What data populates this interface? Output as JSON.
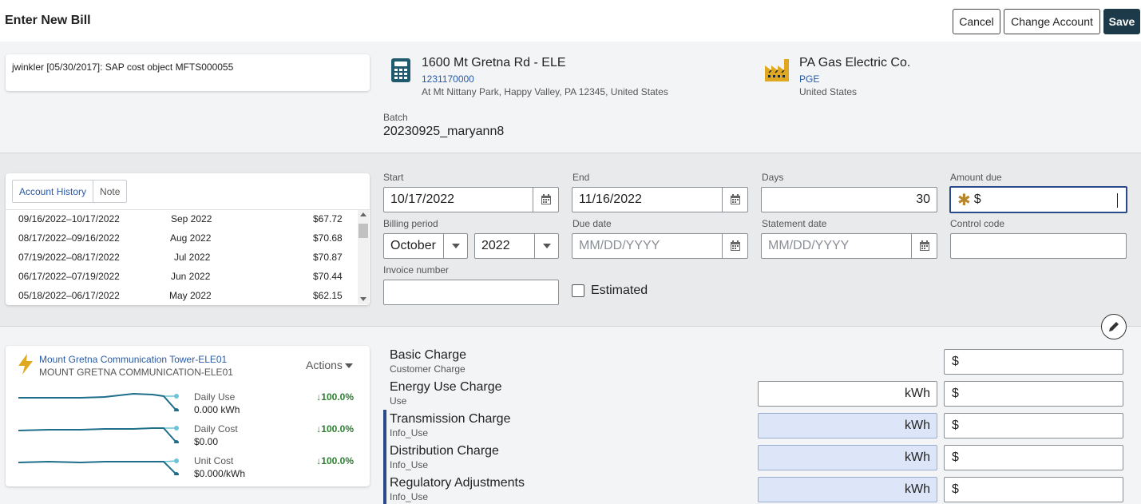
{
  "header": {
    "title": "Enter New Bill",
    "cancel_label": "Cancel",
    "change_account_label": "Change Account",
    "save_label": "Save"
  },
  "note": {
    "text": "jwinkler [05/30/2017]: SAP cost object MFTS000055"
  },
  "account": {
    "name": "1600 Mt Gretna Rd - ELE",
    "number": "1231170000",
    "address": "At Mt Nittany Park, Happy Valley, PA 12345, United States"
  },
  "vendor": {
    "name": "PA Gas Electric Co.",
    "code": "PGE",
    "country": "United States"
  },
  "batch": {
    "label": "Batch",
    "value": "20230925_maryann8"
  },
  "history": {
    "tabs": [
      "Account History",
      "Note"
    ],
    "rows": [
      {
        "range": "09/16/2022–10/17/2022",
        "month": "Sep 2022",
        "amount": "$67.72"
      },
      {
        "range": "08/17/2022–09/16/2022",
        "month": "Aug 2022",
        "amount": "$70.68"
      },
      {
        "range": "07/19/2022–08/17/2022",
        "month": "Jul 2022",
        "amount": "$70.87"
      },
      {
        "range": "06/17/2022–07/19/2022",
        "month": "Jun 2022",
        "amount": "$70.44"
      },
      {
        "range": "05/18/2022–06/17/2022",
        "month": "May 2022",
        "amount": "$62.15"
      }
    ]
  },
  "form": {
    "start": {
      "label": "Start",
      "value": "10/17/2022"
    },
    "end": {
      "label": "End",
      "value": "11/16/2022"
    },
    "days": {
      "label": "Days",
      "value": "30"
    },
    "amount_due": {
      "label": "Amount due",
      "prefix": "$",
      "value": ""
    },
    "billing_period": {
      "label": "Billing period",
      "month": "October",
      "year": "2022"
    },
    "due_date": {
      "label": "Due date",
      "placeholder": "MM/DD/YYYY"
    },
    "statement_date": {
      "label": "Statement date",
      "placeholder": "MM/DD/YYYY"
    },
    "control_code": {
      "label": "Control code",
      "value": ""
    },
    "invoice_number": {
      "label": "Invoice number",
      "value": ""
    },
    "estimated": {
      "label": "Estimated",
      "checked": false
    }
  },
  "meter": {
    "name": "Mount Gretna Communication Tower-ELE01",
    "code": "MOUNT GRETNA COMMUNICATION-ELE01",
    "actions_label": "Actions",
    "metrics": [
      {
        "label": "Daily Use",
        "value": "0.000 kWh",
        "change": "↓100.0%"
      },
      {
        "label": "Daily Cost",
        "value": "$0.00",
        "change": "↓100.0%"
      },
      {
        "label": "Unit Cost",
        "value": "$0.000/kWh",
        "change": "↓100.0%"
      }
    ]
  },
  "charges": [
    {
      "name": "Basic Charge",
      "sub": "Customer Charge",
      "unit": "",
      "currency": "$",
      "info": false
    },
    {
      "name": "Energy Use Charge",
      "sub": "Use",
      "unit": "kWh",
      "currency": "$",
      "info": false
    },
    {
      "name": "Transmission Charge",
      "sub": "Info_Use",
      "unit": "kWh",
      "currency": "$",
      "info": true
    },
    {
      "name": "Distribution Charge",
      "sub": "Info_Use",
      "unit": "kWh",
      "currency": "$",
      "info": true
    },
    {
      "name": "Regulatory Adjustments",
      "sub": "Info_Use",
      "unit": "kWh",
      "currency": "$",
      "info": true
    }
  ],
  "colors": {
    "primary_button": "#1d3a4a",
    "link": "#2a5aa6",
    "teal_icon": "#1f5a6e",
    "vendor_icon": "#e0a820",
    "sparkline": "#1f6f8b",
    "positive": "#2e7d32",
    "info_field": "#dce6f8"
  }
}
